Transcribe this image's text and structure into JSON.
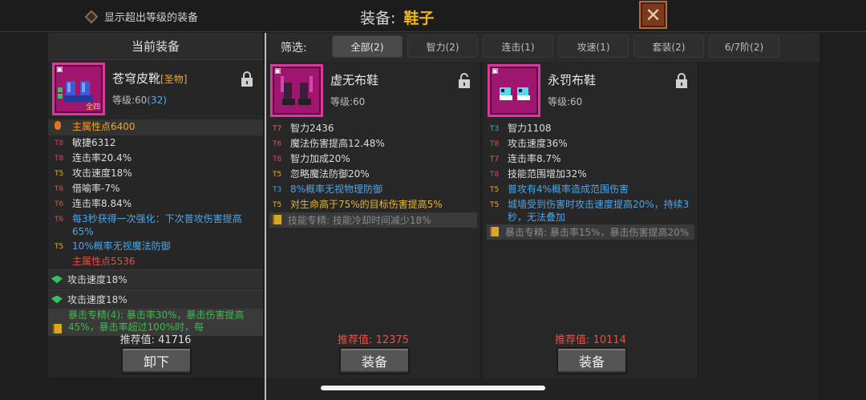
{
  "topbar": {
    "toggle_label": "显示超出等级的装备",
    "title_label": "装备:",
    "title_value": "鞋子"
  },
  "left": {
    "header": "当前装备",
    "item": {
      "name": "苍穹皮靴",
      "tag": "[圣物]",
      "level_label": "等级:60",
      "level_plus": "(32)",
      "icon_tag": "全四"
    },
    "main_attr": "主属性点6400",
    "attrs": [
      {
        "tier": "T8",
        "text": "敏捷6312"
      },
      {
        "tier": "T8",
        "text": "连击率20.4%"
      },
      {
        "tier": "T5",
        "text": "攻击速度18%"
      },
      {
        "tier": "T6",
        "text": "借喻率-7%"
      },
      {
        "tier": "T6",
        "text": "连击率8.84%"
      },
      {
        "tier": "T6",
        "text": "每3秒获得一次强化：下次普攻伤害提高65%"
      },
      {
        "tier": "T5",
        "text": "10%概率无视魔法防御"
      }
    ],
    "sub_attr": "主属性点5536",
    "gems": [
      "攻击速度18%",
      "攻击速度18%"
    ],
    "special": "暴击专精(4): 暴击率30%，暴击伤害提高45%，暴击率超过100%时，每",
    "recommend": "推荐值: 41716",
    "button": "卸下"
  },
  "filter": {
    "label": "筛选:",
    "tabs": [
      "全部(2)",
      "智力(2)",
      "连击(1)",
      "攻速(1)",
      "套装(2)",
      "6/7阶(2)"
    ]
  },
  "cards": [
    {
      "name": "虚无布鞋",
      "level": "等级:60",
      "attrs": [
        {
          "tier": "T7",
          "text": "智力2436"
        },
        {
          "tier": "T6",
          "text": "魔法伤害提高12.48%"
        },
        {
          "tier": "T8",
          "text": "智力加成20%"
        },
        {
          "tier": "T5",
          "text": "忽略魔法防御20%"
        },
        {
          "tier": "T3",
          "text": "8%概率无视物理防御"
        },
        {
          "tier": "T5",
          "text": "对生命高于75%的目标伤害提高5%"
        }
      ],
      "special": "技能专精: 技能冷却时间减少18%",
      "recommend_label": "推荐值:",
      "recommend_value": "12375",
      "button": "装备"
    },
    {
      "name": "永罚布鞋",
      "level": "等级:60",
      "attrs": [
        {
          "tier": "T3",
          "text": "智力1108"
        },
        {
          "tier": "T8",
          "text": "攻击速度36%"
        },
        {
          "tier": "T7",
          "text": "连击率8.7%"
        },
        {
          "tier": "T8",
          "text": "技能范围增加32%"
        },
        {
          "tier": "T5",
          "text": "普攻有4%概率造成范围伤害"
        },
        {
          "tier": "T5",
          "text": "城墙受到伤害时攻击速度提高20%，持续3秒，无法叠加"
        }
      ],
      "special": "暴击专精: 暴击率15%，暴击伤害提高20%",
      "recommend_label": "推荐值:",
      "recommend_value": "10114",
      "button": "装备"
    }
  ]
}
